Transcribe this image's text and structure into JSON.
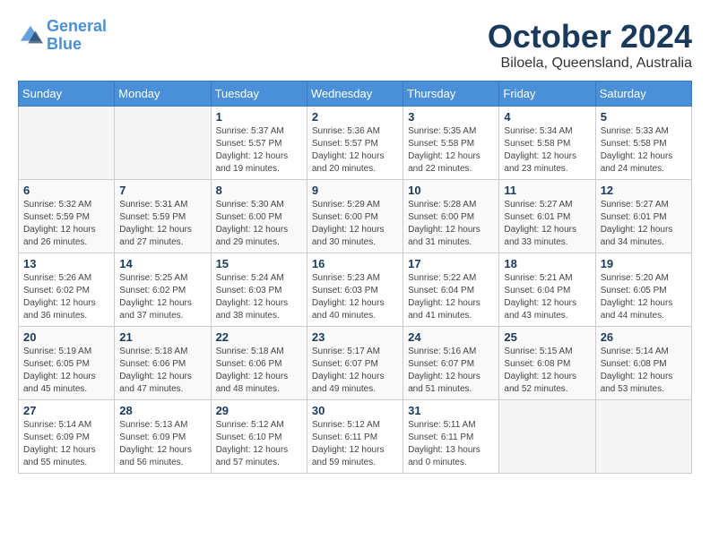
{
  "header": {
    "logo_line1": "General",
    "logo_line2": "Blue",
    "title": "October 2024",
    "subtitle": "Biloela, Queensland, Australia"
  },
  "days_of_week": [
    "Sunday",
    "Monday",
    "Tuesday",
    "Wednesday",
    "Thursday",
    "Friday",
    "Saturday"
  ],
  "weeks": [
    [
      {
        "day": "",
        "info": ""
      },
      {
        "day": "",
        "info": ""
      },
      {
        "day": "1",
        "info": "Sunrise: 5:37 AM\nSunset: 5:57 PM\nDaylight: 12 hours\nand 19 minutes."
      },
      {
        "day": "2",
        "info": "Sunrise: 5:36 AM\nSunset: 5:57 PM\nDaylight: 12 hours\nand 20 minutes."
      },
      {
        "day": "3",
        "info": "Sunrise: 5:35 AM\nSunset: 5:58 PM\nDaylight: 12 hours\nand 22 minutes."
      },
      {
        "day": "4",
        "info": "Sunrise: 5:34 AM\nSunset: 5:58 PM\nDaylight: 12 hours\nand 23 minutes."
      },
      {
        "day": "5",
        "info": "Sunrise: 5:33 AM\nSunset: 5:58 PM\nDaylight: 12 hours\nand 24 minutes."
      }
    ],
    [
      {
        "day": "6",
        "info": "Sunrise: 5:32 AM\nSunset: 5:59 PM\nDaylight: 12 hours\nand 26 minutes."
      },
      {
        "day": "7",
        "info": "Sunrise: 5:31 AM\nSunset: 5:59 PM\nDaylight: 12 hours\nand 27 minutes."
      },
      {
        "day": "8",
        "info": "Sunrise: 5:30 AM\nSunset: 6:00 PM\nDaylight: 12 hours\nand 29 minutes."
      },
      {
        "day": "9",
        "info": "Sunrise: 5:29 AM\nSunset: 6:00 PM\nDaylight: 12 hours\nand 30 minutes."
      },
      {
        "day": "10",
        "info": "Sunrise: 5:28 AM\nSunset: 6:00 PM\nDaylight: 12 hours\nand 31 minutes."
      },
      {
        "day": "11",
        "info": "Sunrise: 5:27 AM\nSunset: 6:01 PM\nDaylight: 12 hours\nand 33 minutes."
      },
      {
        "day": "12",
        "info": "Sunrise: 5:27 AM\nSunset: 6:01 PM\nDaylight: 12 hours\nand 34 minutes."
      }
    ],
    [
      {
        "day": "13",
        "info": "Sunrise: 5:26 AM\nSunset: 6:02 PM\nDaylight: 12 hours\nand 36 minutes."
      },
      {
        "day": "14",
        "info": "Sunrise: 5:25 AM\nSunset: 6:02 PM\nDaylight: 12 hours\nand 37 minutes."
      },
      {
        "day": "15",
        "info": "Sunrise: 5:24 AM\nSunset: 6:03 PM\nDaylight: 12 hours\nand 38 minutes."
      },
      {
        "day": "16",
        "info": "Sunrise: 5:23 AM\nSunset: 6:03 PM\nDaylight: 12 hours\nand 40 minutes."
      },
      {
        "day": "17",
        "info": "Sunrise: 5:22 AM\nSunset: 6:04 PM\nDaylight: 12 hours\nand 41 minutes."
      },
      {
        "day": "18",
        "info": "Sunrise: 5:21 AM\nSunset: 6:04 PM\nDaylight: 12 hours\nand 43 minutes."
      },
      {
        "day": "19",
        "info": "Sunrise: 5:20 AM\nSunset: 6:05 PM\nDaylight: 12 hours\nand 44 minutes."
      }
    ],
    [
      {
        "day": "20",
        "info": "Sunrise: 5:19 AM\nSunset: 6:05 PM\nDaylight: 12 hours\nand 45 minutes."
      },
      {
        "day": "21",
        "info": "Sunrise: 5:18 AM\nSunset: 6:06 PM\nDaylight: 12 hours\nand 47 minutes."
      },
      {
        "day": "22",
        "info": "Sunrise: 5:18 AM\nSunset: 6:06 PM\nDaylight: 12 hours\nand 48 minutes."
      },
      {
        "day": "23",
        "info": "Sunrise: 5:17 AM\nSunset: 6:07 PM\nDaylight: 12 hours\nand 49 minutes."
      },
      {
        "day": "24",
        "info": "Sunrise: 5:16 AM\nSunset: 6:07 PM\nDaylight: 12 hours\nand 51 minutes."
      },
      {
        "day": "25",
        "info": "Sunrise: 5:15 AM\nSunset: 6:08 PM\nDaylight: 12 hours\nand 52 minutes."
      },
      {
        "day": "26",
        "info": "Sunrise: 5:14 AM\nSunset: 6:08 PM\nDaylight: 12 hours\nand 53 minutes."
      }
    ],
    [
      {
        "day": "27",
        "info": "Sunrise: 5:14 AM\nSunset: 6:09 PM\nDaylight: 12 hours\nand 55 minutes."
      },
      {
        "day": "28",
        "info": "Sunrise: 5:13 AM\nSunset: 6:09 PM\nDaylight: 12 hours\nand 56 minutes."
      },
      {
        "day": "29",
        "info": "Sunrise: 5:12 AM\nSunset: 6:10 PM\nDaylight: 12 hours\nand 57 minutes."
      },
      {
        "day": "30",
        "info": "Sunrise: 5:12 AM\nSunset: 6:11 PM\nDaylight: 12 hours\nand 59 minutes."
      },
      {
        "day": "31",
        "info": "Sunrise: 5:11 AM\nSunset: 6:11 PM\nDaylight: 13 hours\nand 0 minutes."
      },
      {
        "day": "",
        "info": ""
      },
      {
        "day": "",
        "info": ""
      }
    ]
  ]
}
